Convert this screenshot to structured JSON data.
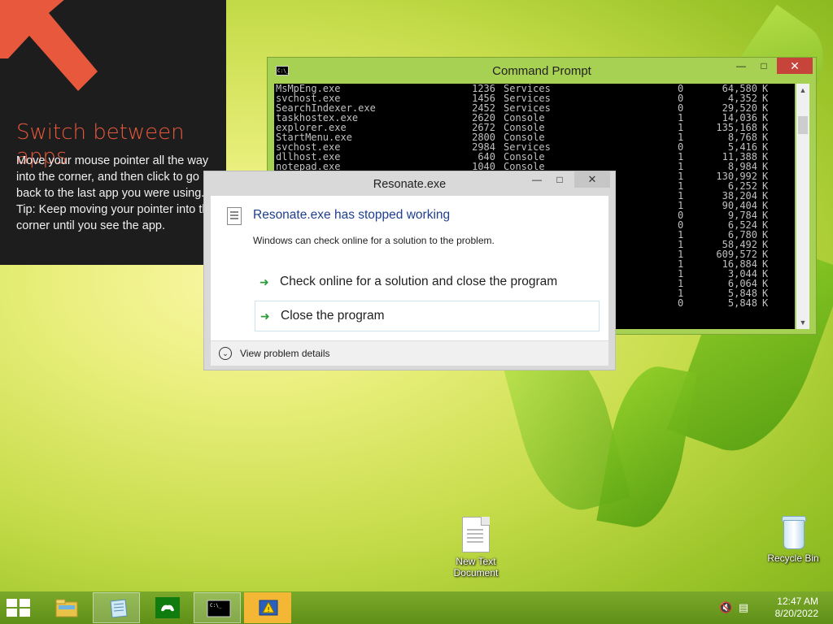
{
  "tip": {
    "title": "Switch between apps",
    "body1": "Move your mouse pointer all the way into the corner, and then click to go back to the last app you were using.",
    "body2": "Tip: Keep moving your pointer into the corner until you see the app.",
    "accent_color": "#e8583c"
  },
  "cmd": {
    "title": "Command Prompt",
    "icon_text": "C:\\_",
    "rows": [
      {
        "name": "MsMpEng.exe",
        "pid": "1236",
        "session": "Services",
        "num": "0",
        "mem": "64,580",
        "unit": "K"
      },
      {
        "name": "svchost.exe",
        "pid": "1456",
        "session": "Services",
        "num": "0",
        "mem": "4,352",
        "unit": "K"
      },
      {
        "name": "SearchIndexer.exe",
        "pid": "2452",
        "session": "Services",
        "num": "0",
        "mem": "29,520",
        "unit": "K"
      },
      {
        "name": "taskhostex.exe",
        "pid": "2620",
        "session": "Console",
        "num": "1",
        "mem": "14,036",
        "unit": "K"
      },
      {
        "name": "explorer.exe",
        "pid": "2672",
        "session": "Console",
        "num": "1",
        "mem": "135,168",
        "unit": "K"
      },
      {
        "name": "StartMenu.exe",
        "pid": "2800",
        "session": "Console",
        "num": "1",
        "mem": "8,768",
        "unit": "K"
      },
      {
        "name": "svchost.exe",
        "pid": "2984",
        "session": "Services",
        "num": "0",
        "mem": "5,416",
        "unit": "K"
      },
      {
        "name": "dllhost.exe",
        "pid": "640",
        "session": "Console",
        "num": "1",
        "mem": "11,388",
        "unit": "K"
      },
      {
        "name": "notepad.exe",
        "pid": "1040",
        "session": "Console",
        "num": "1",
        "mem": "8,984",
        "unit": "K"
      },
      {
        "name": "",
        "pid": "",
        "session": "",
        "num": "1",
        "mem": "130,992",
        "unit": "K"
      },
      {
        "name": "",
        "pid": "",
        "session": "",
        "num": "1",
        "mem": "6,252",
        "unit": "K"
      },
      {
        "name": "",
        "pid": "",
        "session": "",
        "num": "1",
        "mem": "38,204",
        "unit": "K"
      },
      {
        "name": "",
        "pid": "",
        "session": "",
        "num": "1",
        "mem": "90,404",
        "unit": "K"
      },
      {
        "name": "",
        "pid": "",
        "session": "",
        "num": "0",
        "mem": "9,784",
        "unit": "K"
      },
      {
        "name": "",
        "pid": "",
        "session": "",
        "num": "0",
        "mem": "6,524",
        "unit": "K"
      },
      {
        "name": "",
        "pid": "",
        "session": "",
        "num": "1",
        "mem": "6,780",
        "unit": "K"
      },
      {
        "name": "",
        "pid": "",
        "session": "",
        "num": "1",
        "mem": "58,492",
        "unit": "K"
      },
      {
        "name": "",
        "pid": "",
        "session": "",
        "num": "1",
        "mem": "609,572",
        "unit": "K"
      },
      {
        "name": "",
        "pid": "",
        "session": "",
        "num": "1",
        "mem": "16,884",
        "unit": "K"
      },
      {
        "name": "",
        "pid": "",
        "session": "",
        "num": "1",
        "mem": "3,044",
        "unit": "K"
      },
      {
        "name": "",
        "pid": "",
        "session": "",
        "num": "1",
        "mem": "6,064",
        "unit": "K"
      },
      {
        "name": "",
        "pid": "",
        "session": "",
        "num": "1",
        "mem": "5,848",
        "unit": "K"
      },
      {
        "name": "",
        "pid": "",
        "session": "",
        "num": "0",
        "mem": "5,848",
        "unit": "K"
      }
    ]
  },
  "dialog": {
    "title": "Resonate.exe",
    "heading": "Resonate.exe has stopped working",
    "subtext": "Windows can check online for a solution to the problem.",
    "option1": "Check online for a solution and close the program",
    "option2": "Close the program",
    "details": "View problem details"
  },
  "desktop": {
    "text_doc": "New Text Document",
    "recycle_bin": "Recycle Bin"
  },
  "taskbar": {
    "time": "12:47 AM",
    "date": "8/20/2022"
  }
}
